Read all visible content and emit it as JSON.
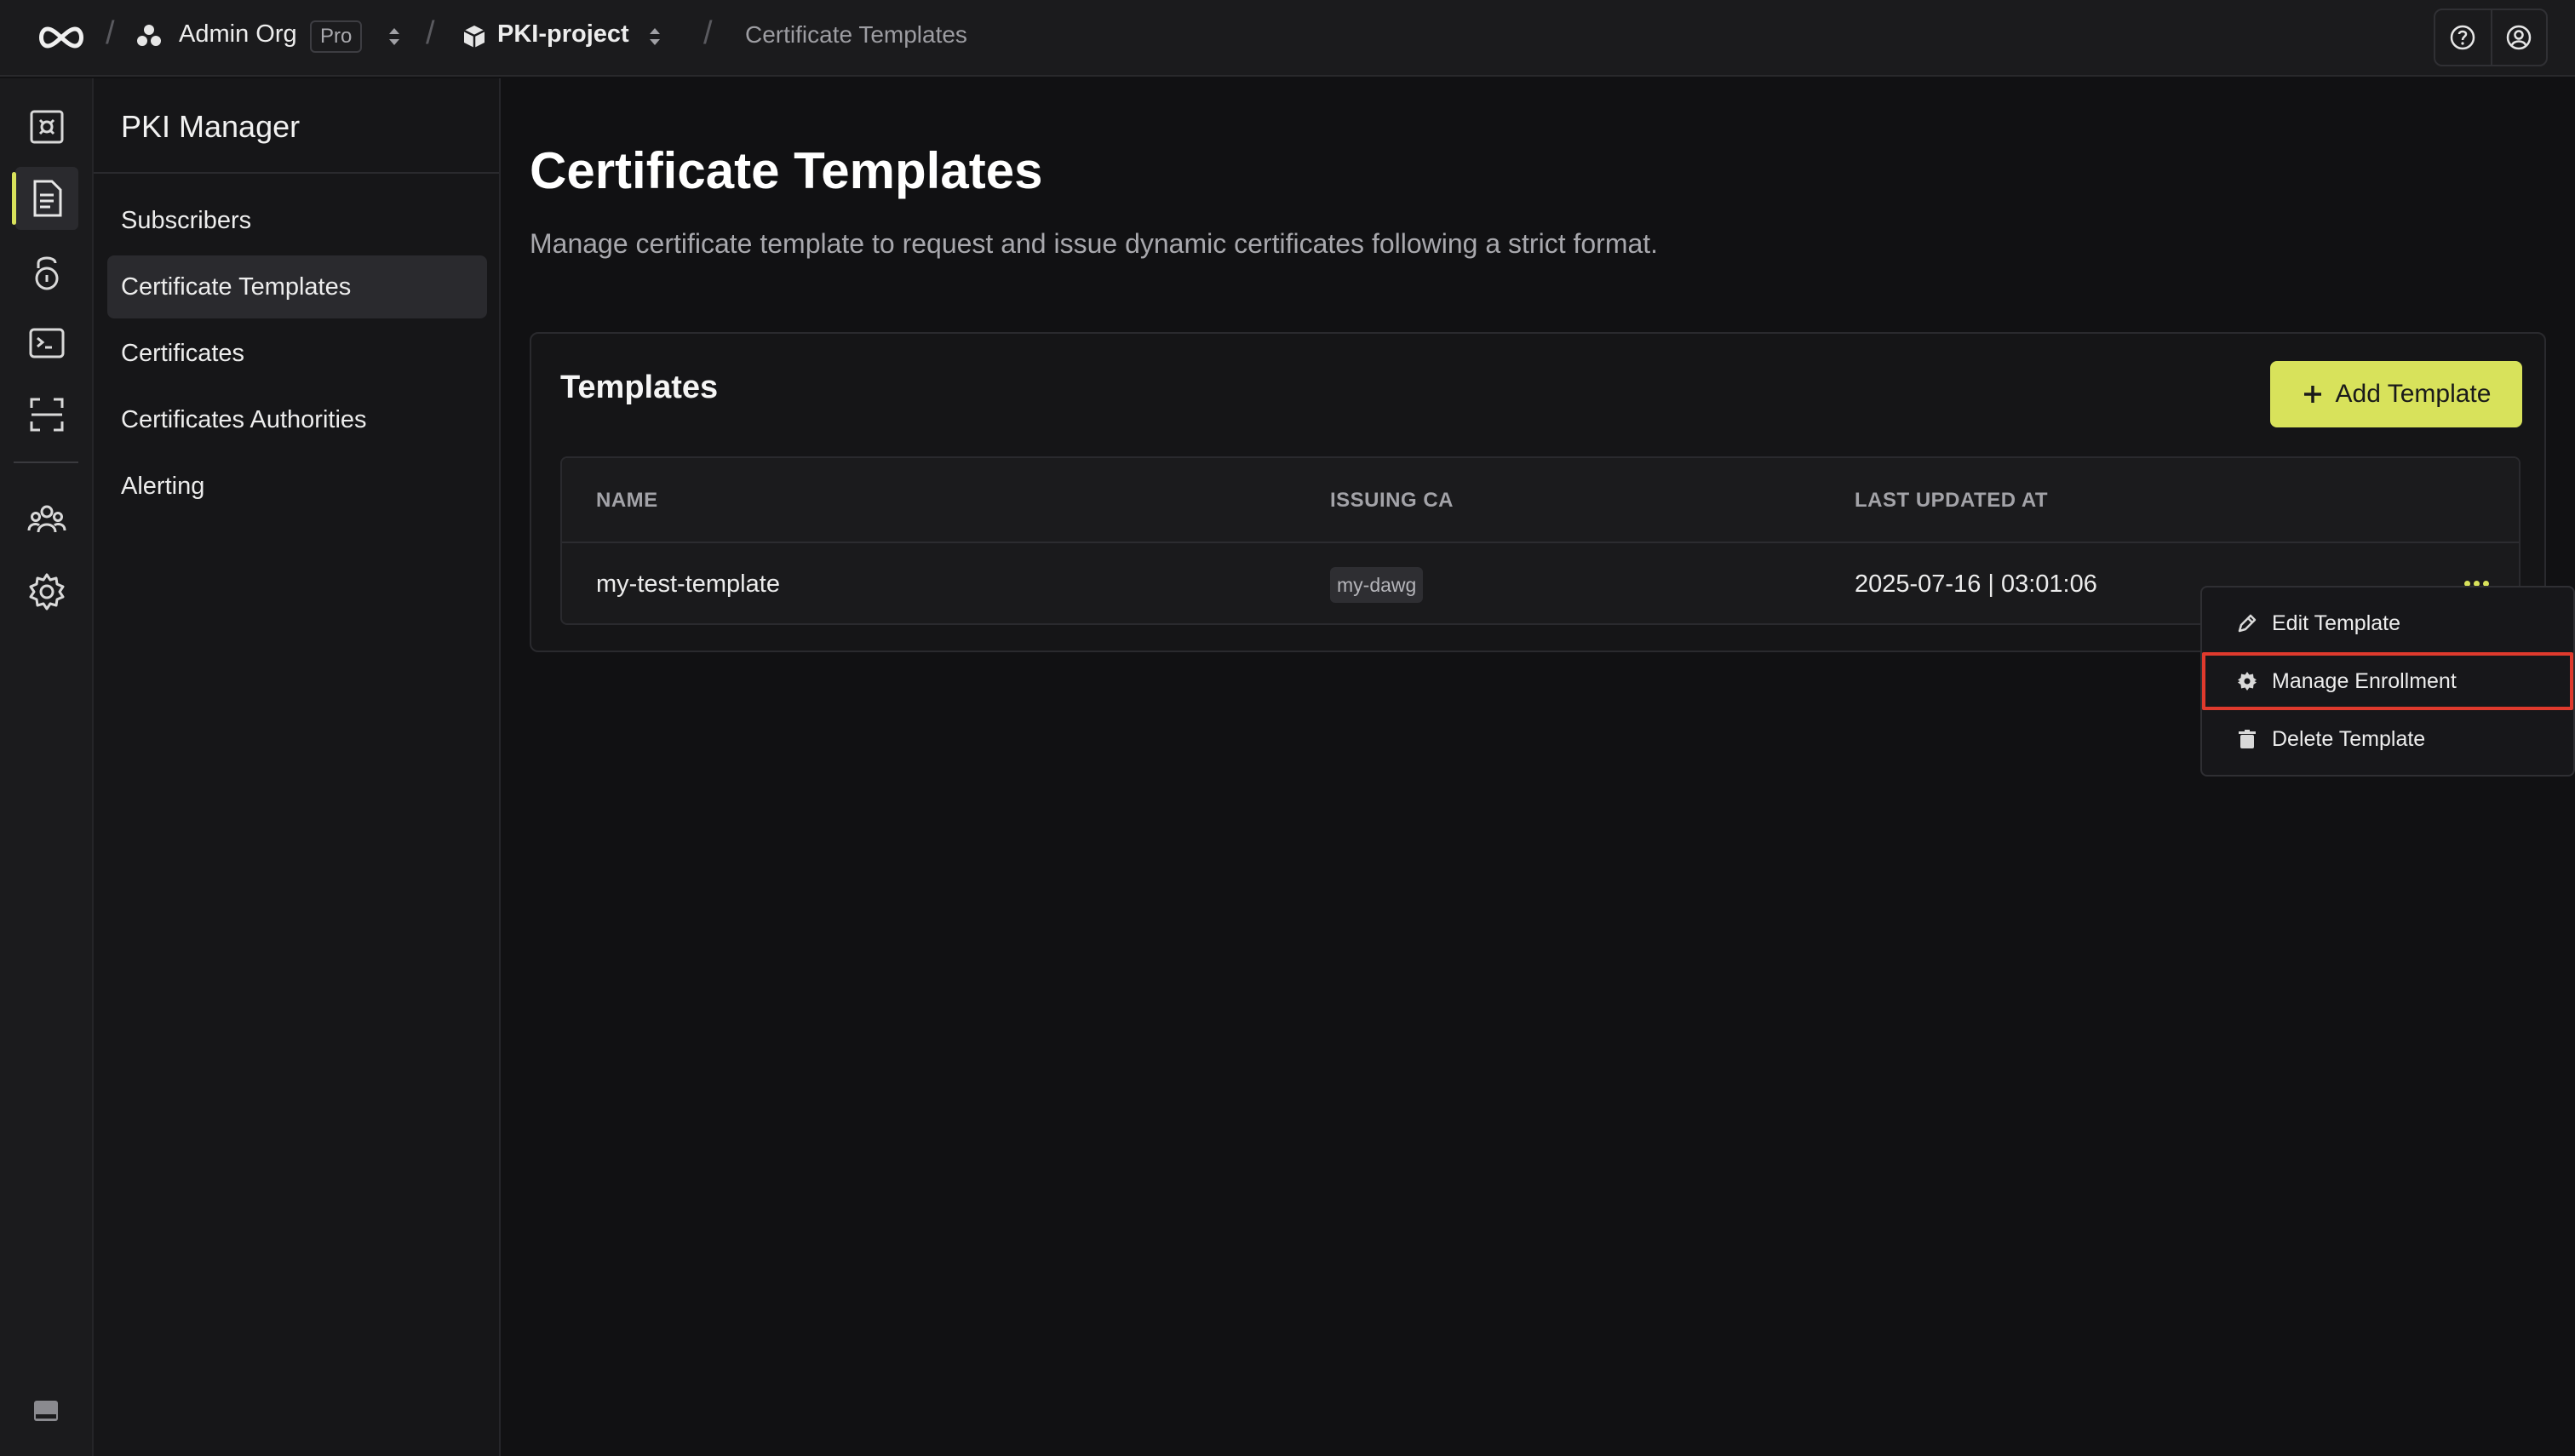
{
  "breadcrumb": {
    "org_name": "Admin Org",
    "org_plan": "Pro",
    "project_name": "PKI-project",
    "current_page": "Certificate Templates"
  },
  "rail": {
    "items": [
      {
        "name": "secret-manager-icon",
        "active": false
      },
      {
        "name": "pki-manager-icon",
        "active": true
      },
      {
        "name": "kms-icon",
        "active": false
      },
      {
        "name": "ssh-icon",
        "active": false
      },
      {
        "name": "scanner-icon",
        "active": false
      },
      {
        "name": "members-icon",
        "active": false
      },
      {
        "name": "settings-icon",
        "active": false
      }
    ]
  },
  "sidebar": {
    "title": "PKI Manager",
    "items": [
      {
        "label": "Subscribers",
        "active": false
      },
      {
        "label": "Certificate Templates",
        "active": true
      },
      {
        "label": "Certificates",
        "active": false
      },
      {
        "label": "Certificates Authorities",
        "active": false
      },
      {
        "label": "Alerting",
        "active": false
      }
    ]
  },
  "main": {
    "title": "Certificate Templates",
    "description": "Manage certificate template to request and issue dynamic certificates following a strict format."
  },
  "card": {
    "title": "Templates",
    "add_button_label": "Add Template",
    "columns": [
      "NAME",
      "ISSUING CA",
      "LAST UPDATED AT"
    ],
    "rows": [
      {
        "name": "my-test-template",
        "issuing_ca": "my-dawg",
        "last_updated": "2025-07-16 | 03:01:06"
      }
    ]
  },
  "menu": {
    "items": [
      {
        "label": "Edit Template",
        "icon": "pencil-icon"
      },
      {
        "label": "Manage Enrollment",
        "icon": "gear-icon",
        "highlighted": true
      },
      {
        "label": "Delete Template",
        "icon": "trash-icon"
      }
    ]
  },
  "colors": {
    "accent": "#d8e25b",
    "highlight_border": "#e03a2d",
    "background": "#111113"
  }
}
